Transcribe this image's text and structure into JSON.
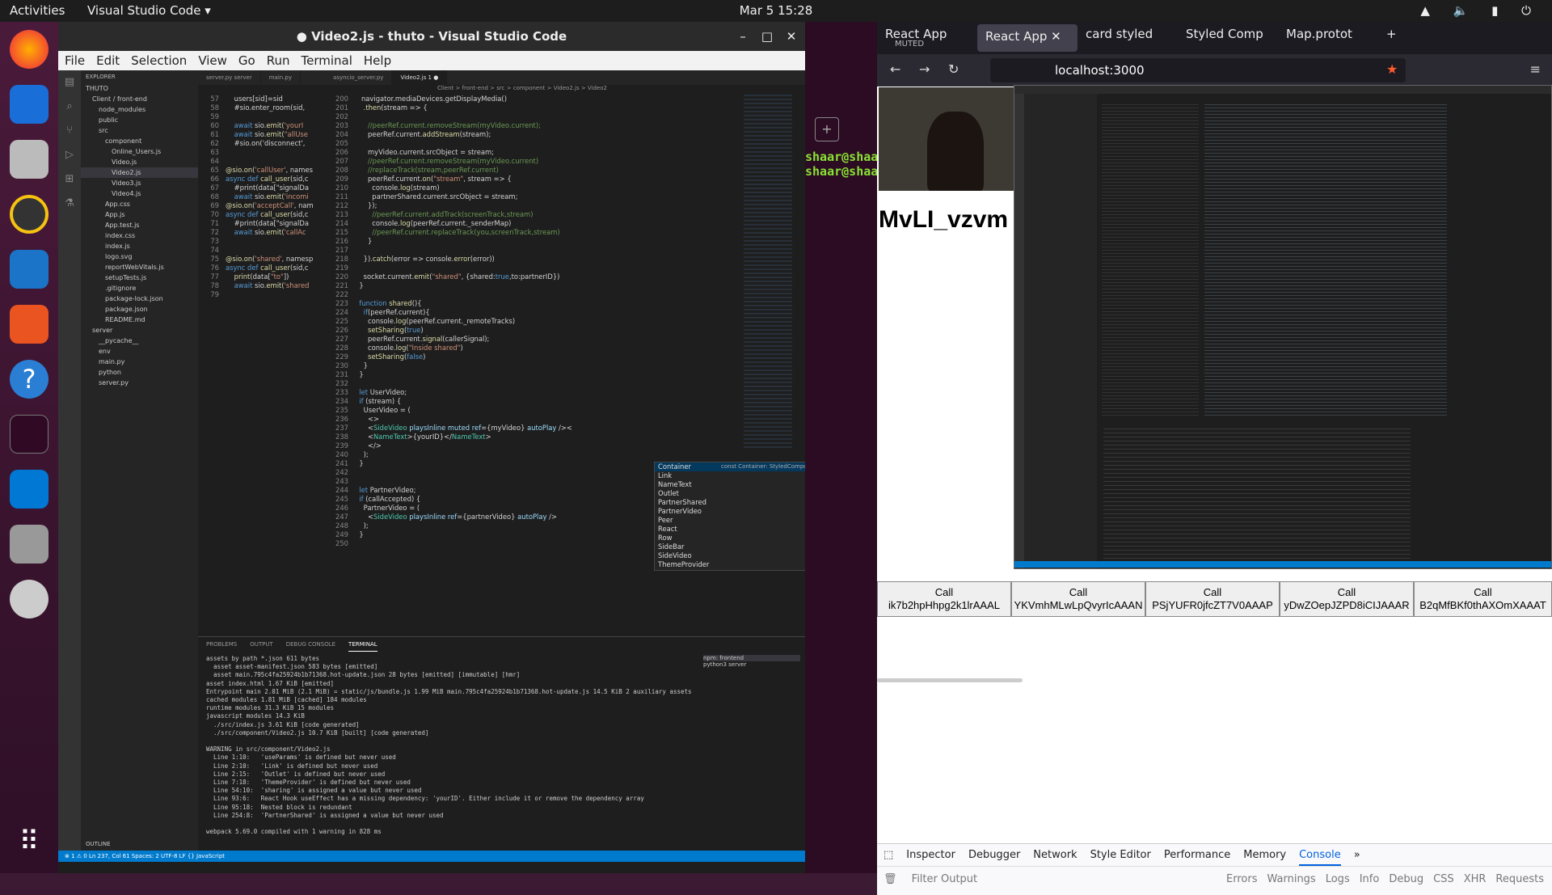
{
  "topbar": {
    "activities": "Activities",
    "app": "Visual Studio Code ▾",
    "clock": "Mar 5  15:28"
  },
  "vscode": {
    "title": "● Video2.js - thuto - Visual Studio Code",
    "menu": [
      "File",
      "Edit",
      "Selection",
      "View",
      "Go",
      "Run",
      "Terminal",
      "Help"
    ],
    "tabs": [
      "server.py server",
      "main.py",
      "asyncio_server.py",
      "Video2.js 1 ●"
    ],
    "breadcrumb": "Client > front-end > src > component > Video2.js > Video2",
    "explorer_title": "EXPLORER",
    "explorer": [
      "THUTO",
      "Client / front-end",
      "node_modules",
      "public",
      "src",
      "component",
      "Online_Users.js",
      "Video.js",
      "Video2.js",
      "Video3.js",
      "Video4.js",
      "App.css",
      "App.js",
      "App.test.js",
      "index.css",
      "index.js",
      "logo.svg",
      "reportWebVitals.js",
      "setupTests.js",
      ".gitignore",
      "package-lock.json",
      "package.json",
      "README.md",
      "server",
      "__pycache__",
      "env",
      "main.py",
      "python",
      "server.py"
    ],
    "outline": "OUTLINE",
    "suggest": [
      "Container",
      "Link",
      "NameText",
      "Outlet",
      "PartnerShared",
      "PartnerVideo",
      "Peer",
      "React",
      "Row",
      "SideBar",
      "SideVideo",
      "ThemeProvider"
    ],
    "suggest_detail": "const Container: StyledComponent<\"di…",
    "panel_tabs": [
      "PROBLEMS",
      "OUTPUT",
      "DEBUG CONSOLE",
      "TERMINAL"
    ],
    "terminals": [
      "npm: frontend",
      "python3 server"
    ],
    "terminal": "assets by path *.json 611 bytes\n  asset asset-manifest.json 583 bytes [emitted]\n  asset main.795c4fa25924b1b71368.hot-update.json 28 bytes [emitted] [immutable] [hmr]\nasset index.html 1.67 KiB [emitted]\nEntrypoint main 2.01 MiB (2.1 MiB) = static/js/bundle.js 1.99 MiB main.795c4fa25924b1b71368.hot-update.js 14.5 KiB 2 auxiliary assets\ncached modules 1.81 MiB [cached] 184 modules\nruntime modules 31.3 KiB 15 modules\njavascript modules 14.3 KiB\n  ./src/index.js 3.61 KiB [code generated]\n  ./src/component/Video2.js 10.7 KiB [built] [code generated]\n\nWARNING in src/component/Video2.js\n  Line 1:10:   'useParams' is defined but never used\n  Line 2:10:   'Link' is defined but never used\n  Line 2:15:   'Outlet' is defined but never used\n  Line 7:18:   'ThemeProvider' is defined but never used\n  Line 54:10:  'sharing' is assigned a value but never used\n  Line 93:6:   React Hook useEffect has a missing dependency: 'yourID'. Either include it or remove the dependency array\n  Line 95:18:  Nested block is redundant\n  Line 254:8:  'PartnerShared' is assigned a value but never used\n\nwebpack 5.69.0 compiled with 1 warning in 828 ms",
    "status": "⊗ 1 ⚠ 0                                                                                                                                                            Ln 237, Col 61   Spaces: 2   UTF-8   LF   {} JavaScript"
  },
  "firefox": {
    "tabs": [
      {
        "t": "React App",
        "sub": "MUTED"
      },
      {
        "t": "React App",
        "sub": ""
      },
      {
        "t": "card styled",
        "sub": ""
      },
      {
        "t": "Styled Comp",
        "sub": ""
      },
      {
        "t": "Map.protot",
        "sub": ""
      }
    ],
    "url": "localhost:3000",
    "your_id": "MvLI_vzvm",
    "calls": [
      {
        "l1": "Call",
        "l2": "ik7b2hpHhpg2k1lrAAAL"
      },
      {
        "l1": "Call",
        "l2": "YKVmhMLwLpQvyrIcAAAN"
      },
      {
        "l1": "Call",
        "l2": "PSjYUFR0jfcZT7V0AAAP"
      },
      {
        "l1": "Call",
        "l2": "yDwZOepJZPD8iCIJAAAR"
      },
      {
        "l1": "Call",
        "l2": "B2qMfBKf0thAXOmXAAAT"
      }
    ],
    "devtools": [
      "Inspector",
      "Debugger",
      "Network",
      "Style Editor",
      "Performance",
      "Memory",
      "Console"
    ],
    "filter": "Filter Output",
    "levels": [
      "Errors",
      "Warnings",
      "Logs",
      "Info",
      "Debug",
      "CSS",
      "XHR",
      "Requests"
    ]
  },
  "terminal_behind": [
    "shaar@shaa",
    "shaar@shaa"
  ]
}
